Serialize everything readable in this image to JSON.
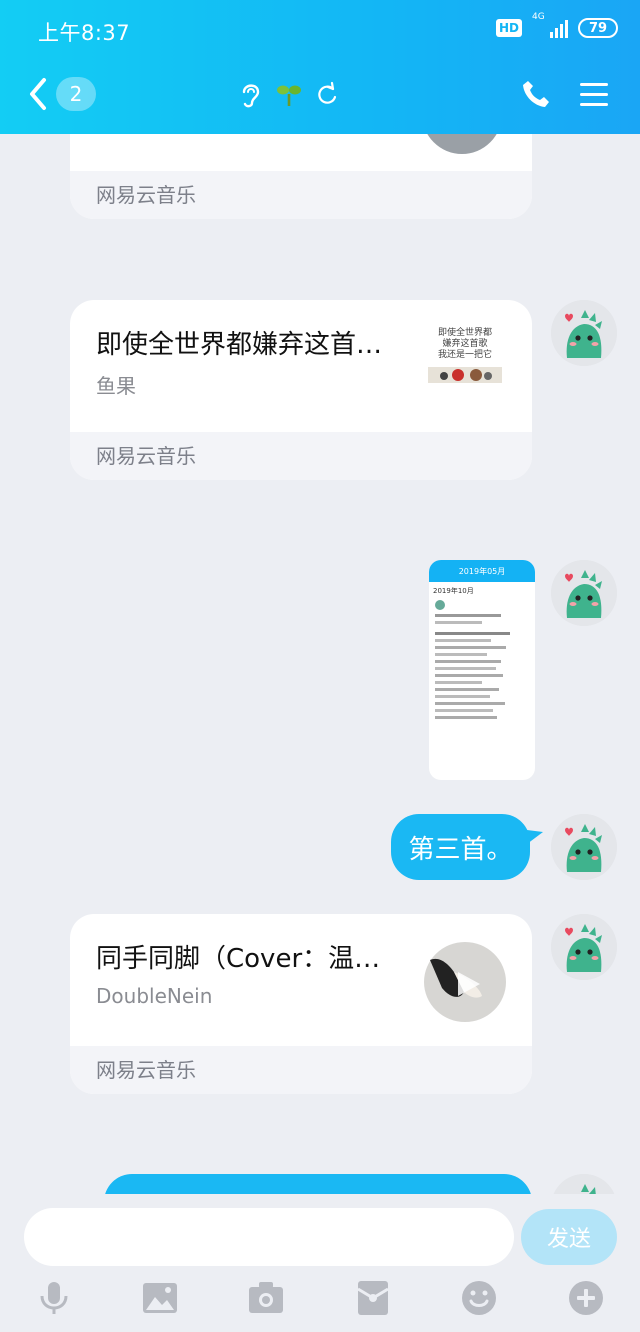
{
  "status": {
    "time": "上午8:37",
    "hd": "HD",
    "network": "4G",
    "battery": "79"
  },
  "header": {
    "back_count": "2"
  },
  "messages": {
    "card0": {
      "source": "网易云音乐"
    },
    "card1": {
      "title": "即使全世界都嫌弃这首…",
      "artist": "鱼果",
      "source": "网易云音乐",
      "thumb_lines": [
        "即使全世界都",
        "嫌弃这首歌",
        "我还是一把它"
      ]
    },
    "screenshot": {
      "title": "2019年05月",
      "heading": "2019年10月"
    },
    "text1": "第三首。",
    "card2": {
      "title": "同手同脚（Cover：温…",
      "artist": "DoubleNein",
      "source": "网易云音乐"
    }
  },
  "input": {
    "placeholder": "",
    "send_label": "发送"
  },
  "colors": {
    "accent": "#13b6f5",
    "bubble": "#1ab8f3",
    "background": "#eceef3"
  },
  "toolbar_icons": [
    "mic-icon",
    "image-icon",
    "camera-icon",
    "red-packet-icon",
    "emoji-icon",
    "plus-icon"
  ]
}
